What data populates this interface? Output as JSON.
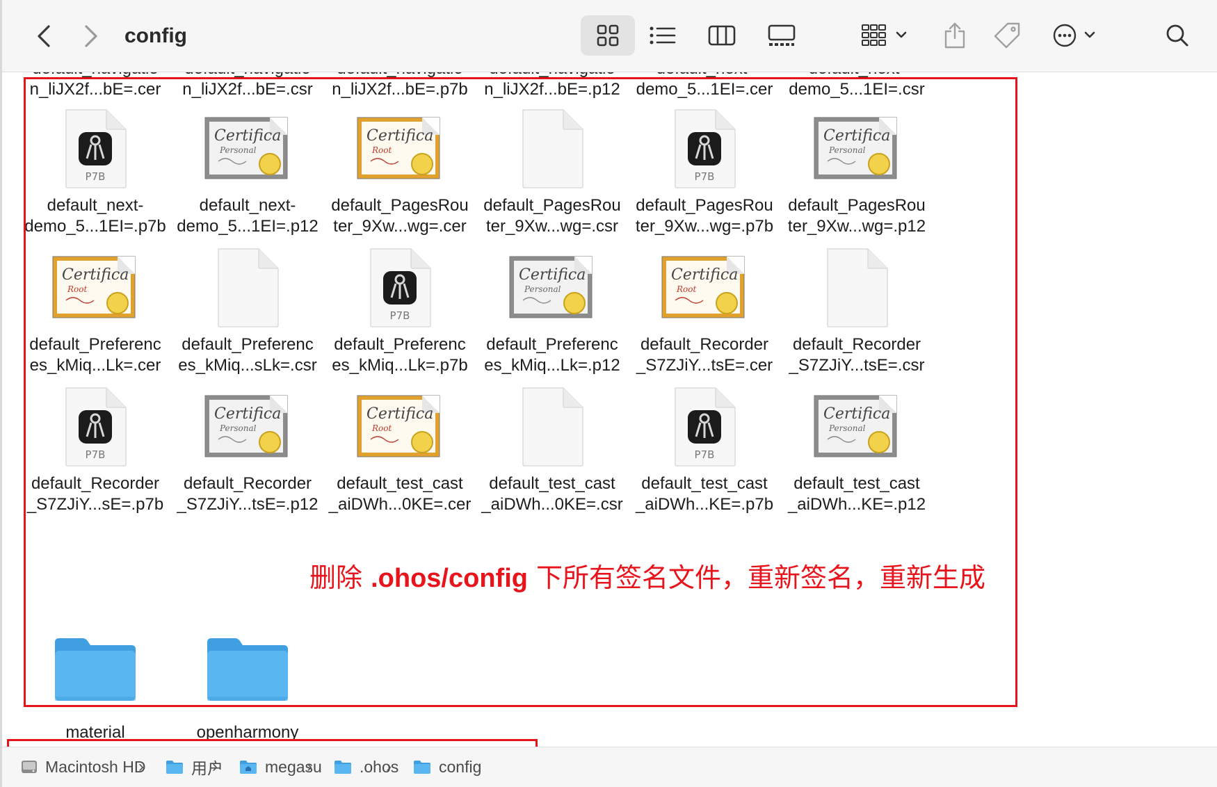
{
  "window": {
    "title": "config"
  },
  "toolbar": {
    "back": "back",
    "forward": "forward",
    "views": [
      "icon-view",
      "list-view",
      "column-view",
      "gallery-view"
    ],
    "actions": [
      "group",
      "share",
      "tags",
      "more",
      "search"
    ]
  },
  "top_row_labels": [
    {
      "line1": "default_navigatio",
      "line2": "n_liJX2f...bE=.cer"
    },
    {
      "line1": "default_navigatio",
      "line2": "n_liJX2f...bE=.csr"
    },
    {
      "line1": "default_navigatio",
      "line2": "n_liJX2f...bE=.p7b"
    },
    {
      "line1": "default_navigatio",
      "line2": "n_liJX2f...bE=.p12"
    },
    {
      "line1": "default_next-",
      "line2": "demo_5...1EI=.cer"
    },
    {
      "line1": "default_next-",
      "line2": "demo_5...1EI=.csr"
    }
  ],
  "files": [
    {
      "kind": "p7b",
      "badge": "P7B",
      "name": "default_next-\ndemo_5...1EI=.p7b"
    },
    {
      "kind": "cert-personal",
      "name": "default_next-\ndemo_5...1EI=.p12"
    },
    {
      "kind": "cert-root",
      "name": "default_PagesRou\nter_9Xw...wg=.cer"
    },
    {
      "kind": "blank",
      "name": "default_PagesRou\nter_9Xw...wg=.csr"
    },
    {
      "kind": "p7b",
      "badge": "P7B",
      "name": "default_PagesRou\nter_9Xw...wg=.p7b"
    },
    {
      "kind": "cert-personal",
      "name": "default_PagesRou\nter_9Xw...wg=.p12"
    },
    {
      "kind": "cert-root",
      "name": "default_Preferenc\nes_kMiq...Lk=.cer"
    },
    {
      "kind": "blank",
      "name": "default_Preferenc\nes_kMiq...sLk=.csr"
    },
    {
      "kind": "p7b",
      "badge": "P7B",
      "name": "default_Preferenc\nes_kMiq...Lk=.p7b"
    },
    {
      "kind": "cert-personal",
      "name": "default_Preferenc\nes_kMiq...Lk=.p12"
    },
    {
      "kind": "cert-root",
      "name": "default_Recorder\n_S7ZJiY...tsE=.cer"
    },
    {
      "kind": "blank",
      "name": "default_Recorder\n_S7ZJiY...tsE=.csr"
    },
    {
      "kind": "p7b",
      "badge": "P7B",
      "name": "default_Recorder\n_S7ZJiY...sE=.p7b"
    },
    {
      "kind": "cert-personal",
      "name": "default_Recorder\n_S7ZJiY...tsE=.p12"
    },
    {
      "kind": "cert-root",
      "name": "default_test_cast\n_aiDWh...0KE=.cer"
    },
    {
      "kind": "blank",
      "name": "default_test_cast\n_aiDWh...0KE=.csr"
    },
    {
      "kind": "p7b",
      "badge": "P7B",
      "name": "default_test_cast\n_aiDWh...KE=.p7b"
    },
    {
      "kind": "cert-personal",
      "name": "default_test_cast\n_aiDWh...KE=.p12"
    },
    {
      "kind": "folder",
      "name": "material"
    },
    {
      "kind": "folder",
      "name": "openharmony"
    }
  ],
  "cert_text": {
    "heading": "Certificate",
    "personal": "Personal",
    "root": "Root"
  },
  "annotation": {
    "prefix": "删除 ",
    "path": ".ohos/config",
    "suffix": " 下所有签名文件，重新签名，重新生成"
  },
  "pathbar": [
    {
      "icon": "disk-icon",
      "label": "Macintosh HD"
    },
    {
      "icon": "folder-icon",
      "label": "用户"
    },
    {
      "icon": "home-folder-icon",
      "label": "megasu"
    },
    {
      "icon": "folder-icon",
      "label": ".ohos"
    },
    {
      "icon": "folder-icon",
      "label": "config"
    }
  ],
  "colors": {
    "annotation_red": "#e8141c",
    "folder_blue": "#5ab6f0",
    "cert_root_frame": "#e2a12c",
    "cert_personal_frame": "#8c8c8c"
  }
}
